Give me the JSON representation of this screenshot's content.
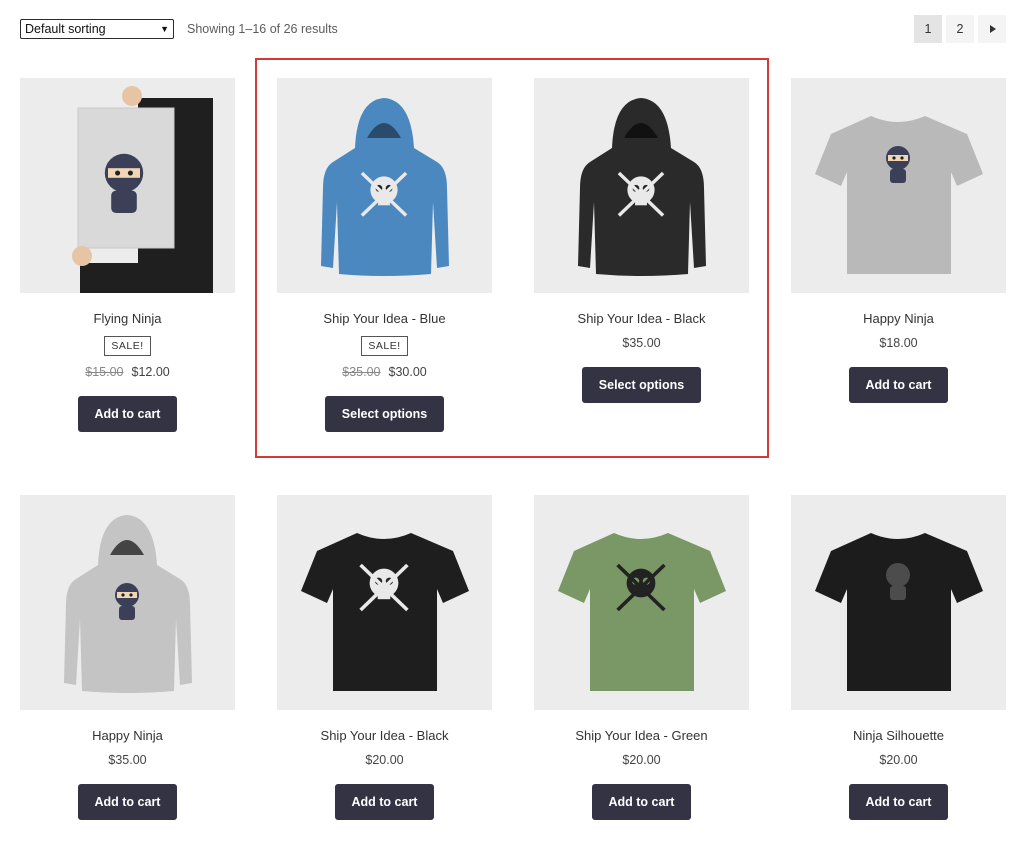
{
  "toolbar": {
    "sort_value": "Default sorting",
    "result_count": "Showing 1–16 of 26 results"
  },
  "pagination": {
    "pages": [
      "1",
      "2"
    ],
    "current": "1",
    "next_icon": "next-arrow-icon"
  },
  "colors": {
    "button_bg": "#333344",
    "highlight_border": "#d23a3a",
    "thumb_bg": "#ececec"
  },
  "products": [
    {
      "title": "Flying Ninja",
      "sale": "SALE!",
      "old_price": "$15.00",
      "price": "$12.00",
      "button": "Add to cart",
      "image": "ninja-poster"
    },
    {
      "title": "Ship Your Idea - Blue",
      "sale": "SALE!",
      "old_price": "$35.00",
      "price": "$30.00",
      "button": "Select options",
      "image": "blue-hoodie"
    },
    {
      "title": "Ship Your Idea - Black",
      "sale": "",
      "old_price": "",
      "price": "$35.00",
      "button": "Select options",
      "image": "black-hoodie"
    },
    {
      "title": "Happy Ninja",
      "sale": "",
      "old_price": "",
      "price": "$18.00",
      "button": "Add to cart",
      "image": "grey-ninja-tshirt"
    },
    {
      "title": "Happy Ninja",
      "sale": "",
      "old_price": "",
      "price": "$35.00",
      "button": "Add to cart",
      "image": "grey-ninja-hoodie"
    },
    {
      "title": "Ship Your Idea - Black",
      "sale": "",
      "old_price": "",
      "price": "$20.00",
      "button": "Add to cart",
      "image": "black-skull-tshirt"
    },
    {
      "title": "Ship Your Idea - Green",
      "sale": "",
      "old_price": "",
      "price": "$20.00",
      "button": "Add to cart",
      "image": "green-skull-tshirt"
    },
    {
      "title": "Ninja Silhouette",
      "sale": "",
      "old_price": "",
      "price": "$20.00",
      "button": "Add to cart",
      "image": "black-ninja-tshirt"
    }
  ]
}
